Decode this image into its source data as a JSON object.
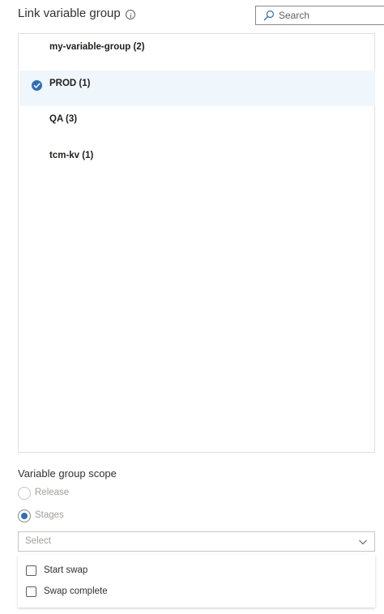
{
  "header": {
    "title": "Link variable group",
    "info_icon": "info-icon"
  },
  "search": {
    "placeholder": "Search",
    "value": "",
    "icon": "search-icon"
  },
  "variable_groups": [
    {
      "label": "my-variable-group (2)",
      "selected": false
    },
    {
      "label": "PROD (1)",
      "selected": true
    },
    {
      "label": "QA (3)",
      "selected": false
    },
    {
      "label": "tcm-kv (1)",
      "selected": false
    }
  ],
  "scope": {
    "title": "Variable group scope",
    "options": [
      {
        "label": "Release",
        "checked": false
      },
      {
        "label": "Stages",
        "checked": true
      }
    ]
  },
  "stage_select": {
    "placeholder": "Select",
    "icon": "chevron-down-icon",
    "options": [
      {
        "label": "Start swap",
        "checked": false
      },
      {
        "label": "Swap complete",
        "checked": false
      }
    ]
  },
  "colors": {
    "accent": "#2f6fba",
    "selected_row": "#eff6fc",
    "border": "#e1dfdd",
    "disabled_text": "#a19f9d"
  }
}
